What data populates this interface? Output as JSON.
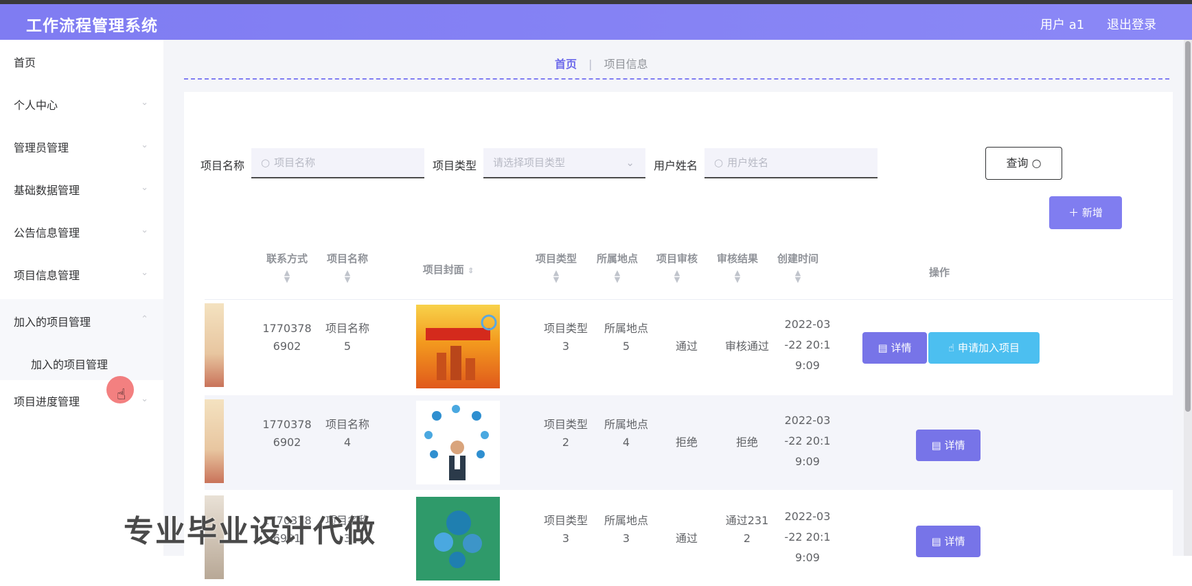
{
  "app": {
    "title": "工作流程管理系统",
    "user": "用户 a1",
    "logout": "退出登录"
  },
  "sidebar": {
    "items": [
      {
        "label": "首页"
      },
      {
        "label": "个人中心"
      },
      {
        "label": "管理员管理"
      },
      {
        "label": "基础数据管理"
      },
      {
        "label": "公告信息管理"
      },
      {
        "label": "项目信息管理"
      },
      {
        "label": "加入的项目管理"
      },
      {
        "label": "项目进度管理"
      }
    ],
    "submenu": {
      "label": "加入的项目管理"
    }
  },
  "breadcrumb": {
    "home": "首页",
    "current": "项目信息"
  },
  "filters": {
    "name_label": "项目名称",
    "name_placeholder": "项目名称",
    "type_label": "项目类型",
    "type_placeholder": "请选择项目类型",
    "user_label": "用户姓名",
    "user_placeholder": "用户姓名",
    "query_button": "查询",
    "add_button": "新增"
  },
  "table": {
    "headers": {
      "contact": "联系方式",
      "name": "项目名称",
      "cover": "项目封面",
      "type": "项目类型",
      "location": "所属地点",
      "review": "项目审核",
      "result": "审核结果",
      "created": "创建时间",
      "ops": "操作"
    },
    "rows": [
      {
        "contact": [
          "1770378",
          "6902"
        ],
        "name": [
          "项目名称",
          "5"
        ],
        "type": [
          "项目类型",
          "3"
        ],
        "location": [
          "所属地点",
          "5"
        ],
        "review": "通过",
        "result": "审核通过",
        "created": [
          "2022-03",
          "-22 20:1",
          "9:09"
        ],
        "detail": "详情",
        "apply": "申请加入项目"
      },
      {
        "contact": [
          "1770378",
          "6902"
        ],
        "name": [
          "项目名称",
          "4"
        ],
        "type": [
          "项目类型",
          "2"
        ],
        "location": [
          "所属地点",
          "4"
        ],
        "review": "拒绝",
        "result": "拒绝",
        "created": [
          "2022-03",
          "-22 20:1",
          "9:09"
        ],
        "detail": "详情"
      },
      {
        "contact": [
          "1770378",
          "6901"
        ],
        "name": [
          "项目名称",
          "3"
        ],
        "type": [
          "项目类型",
          "3"
        ],
        "location": [
          "所属地点",
          "3"
        ],
        "review": "通过",
        "result": [
          "通过231",
          "2"
        ],
        "created": [
          "2022-03",
          "-22 20:1",
          "9:09"
        ],
        "detail": "详情"
      }
    ]
  },
  "watermark": "专业毕业设计代做",
  "colors": {
    "accent": "#7f7cf2",
    "apply": "#4cbff0",
    "detail": "#7774e8"
  }
}
